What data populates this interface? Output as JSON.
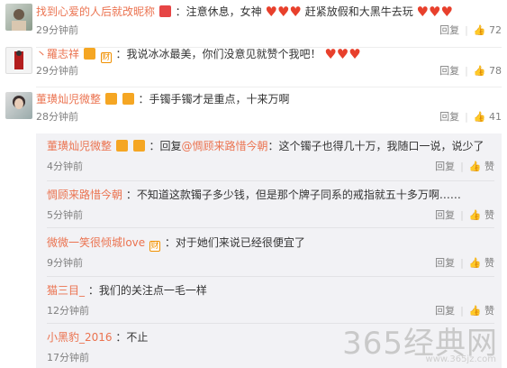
{
  "comments": [
    {
      "user": "找到心爱的人后就改昵称",
      "text_a": "：注意休息，女神",
      "text_b": "赶紧放假和大黑牛去玩",
      "time": "29分钟前",
      "reply_label": "回复",
      "like_count": "72"
    },
    {
      "user": "丶羅志祥",
      "text": "：我说冰冰最美，你们没意见就赞个我吧！",
      "time": "29分钟前",
      "reply_label": "回复",
      "like_count": "78"
    },
    {
      "user": "董璜灿児微整",
      "text": "：手镯手镯才是重点，十来万啊",
      "time": "28分钟前",
      "reply_label": "回复",
      "like_count": "41"
    }
  ],
  "replies": [
    {
      "user": "董璜灿児微整",
      "text_pre": "：回复",
      "mention": "@惆顾来路惜今朝",
      "text": "：这个镯子也得几十万，我随口一说，说少了",
      "time": "4分钟前",
      "reply_label": "回复",
      "like_label": "赞"
    },
    {
      "user": "惆顾来路惜今朝",
      "text": "：不知道这款镯子多少钱，但是那个牌子同系的戒指就五十多万啊……",
      "time": "5分钟前",
      "reply_label": "回复",
      "like_label": "赞"
    },
    {
      "user": "微微一笑很倾城love",
      "text": "：对于她们来说已经很便宜了",
      "time": "9分钟前",
      "reply_label": "回复",
      "like_label": "赞"
    },
    {
      "user": "猫三目_",
      "text": "：我们的关注点一毛一样",
      "time": "12分钟前",
      "reply_label": "回复",
      "like_label": "赞"
    },
    {
      "user": "小黑豹_2016",
      "text": "：不止",
      "time": "17分钟前",
      "reply_label": "回复",
      "like_label": "赞"
    }
  ],
  "badge_text": "财",
  "watermark": {
    "main": "365经典网",
    "sub": "www.365jz.com"
  },
  "colors": {
    "username": "#eb7350",
    "heart": "#e8402c",
    "reply_bg": "#f2f2f5"
  }
}
